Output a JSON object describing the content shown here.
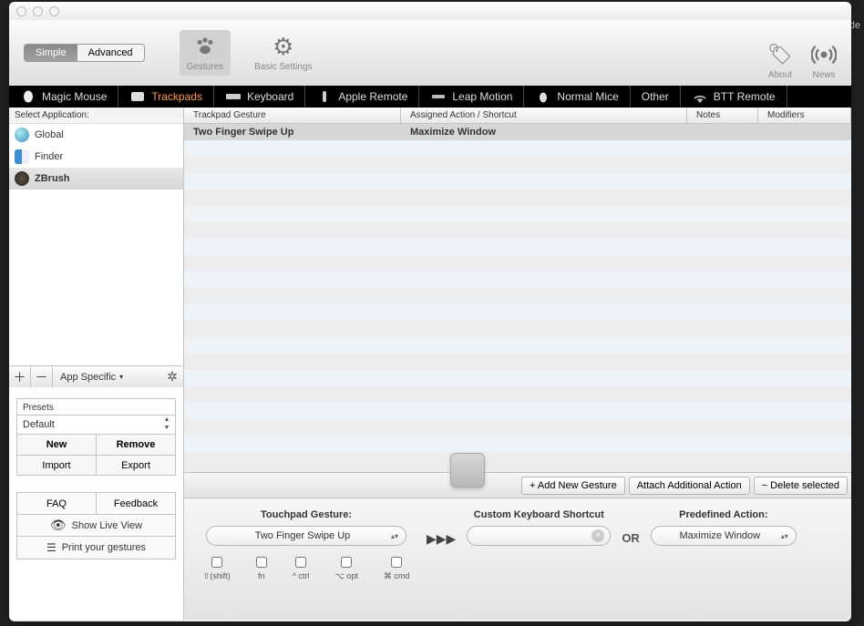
{
  "toolbar": {
    "seg_simple": "Simple",
    "seg_advanced": "Advanced",
    "gestures": "Gestures",
    "basic_settings": "Basic Settings",
    "about": "About",
    "news": "News"
  },
  "tabs": [
    {
      "label": "Magic Mouse"
    },
    {
      "label": "Trackpads"
    },
    {
      "label": "Keyboard"
    },
    {
      "label": "Apple Remote"
    },
    {
      "label": "Leap Motion"
    },
    {
      "label": "Normal Mice"
    },
    {
      "label": "Other"
    },
    {
      "label": "BTT Remote"
    }
  ],
  "sidebar": {
    "header": "Select Application:",
    "items": [
      {
        "label": "Global"
      },
      {
        "label": "Finder"
      },
      {
        "label": "ZBrush"
      }
    ],
    "app_specific": "App Specific"
  },
  "presets": {
    "label": "Presets",
    "value": "Default",
    "new_btn": "New",
    "remove_btn": "Remove",
    "import_btn": "Import",
    "export_btn": "Export"
  },
  "help": {
    "faq": "FAQ",
    "feedback": "Feedback",
    "live_view": "Show Live View",
    "print": "Print your gestures"
  },
  "columns": {
    "c1": "Trackpad Gesture",
    "c2": "Assigned Action / Shortcut",
    "c3": "Notes",
    "c4": "Modifiers"
  },
  "gesture_rows": [
    {
      "gesture": "Two Finger Swipe Up",
      "action": "Maximize Window",
      "notes": "",
      "mods": ""
    }
  ],
  "actions": {
    "add": "+ Add New Gesture",
    "attach": "Attach Additional Action",
    "delete": "− Delete selected"
  },
  "config": {
    "gesture_label": "Touchpad Gesture:",
    "gesture_value": "Two Finger Swipe Up",
    "shortcut_label": "Custom Keyboard Shortcut",
    "shortcut_value": "",
    "or_label": "OR",
    "action_label": "Predefined Action:",
    "action_value": "Maximize Window",
    "mods": {
      "shift": "⇧(shift)",
      "fn": "fn",
      "ctrl": "^ ctrl",
      "opt": "⌥ opt",
      "cmd": "⌘ cmd"
    }
  },
  "bg_extra": "lide"
}
